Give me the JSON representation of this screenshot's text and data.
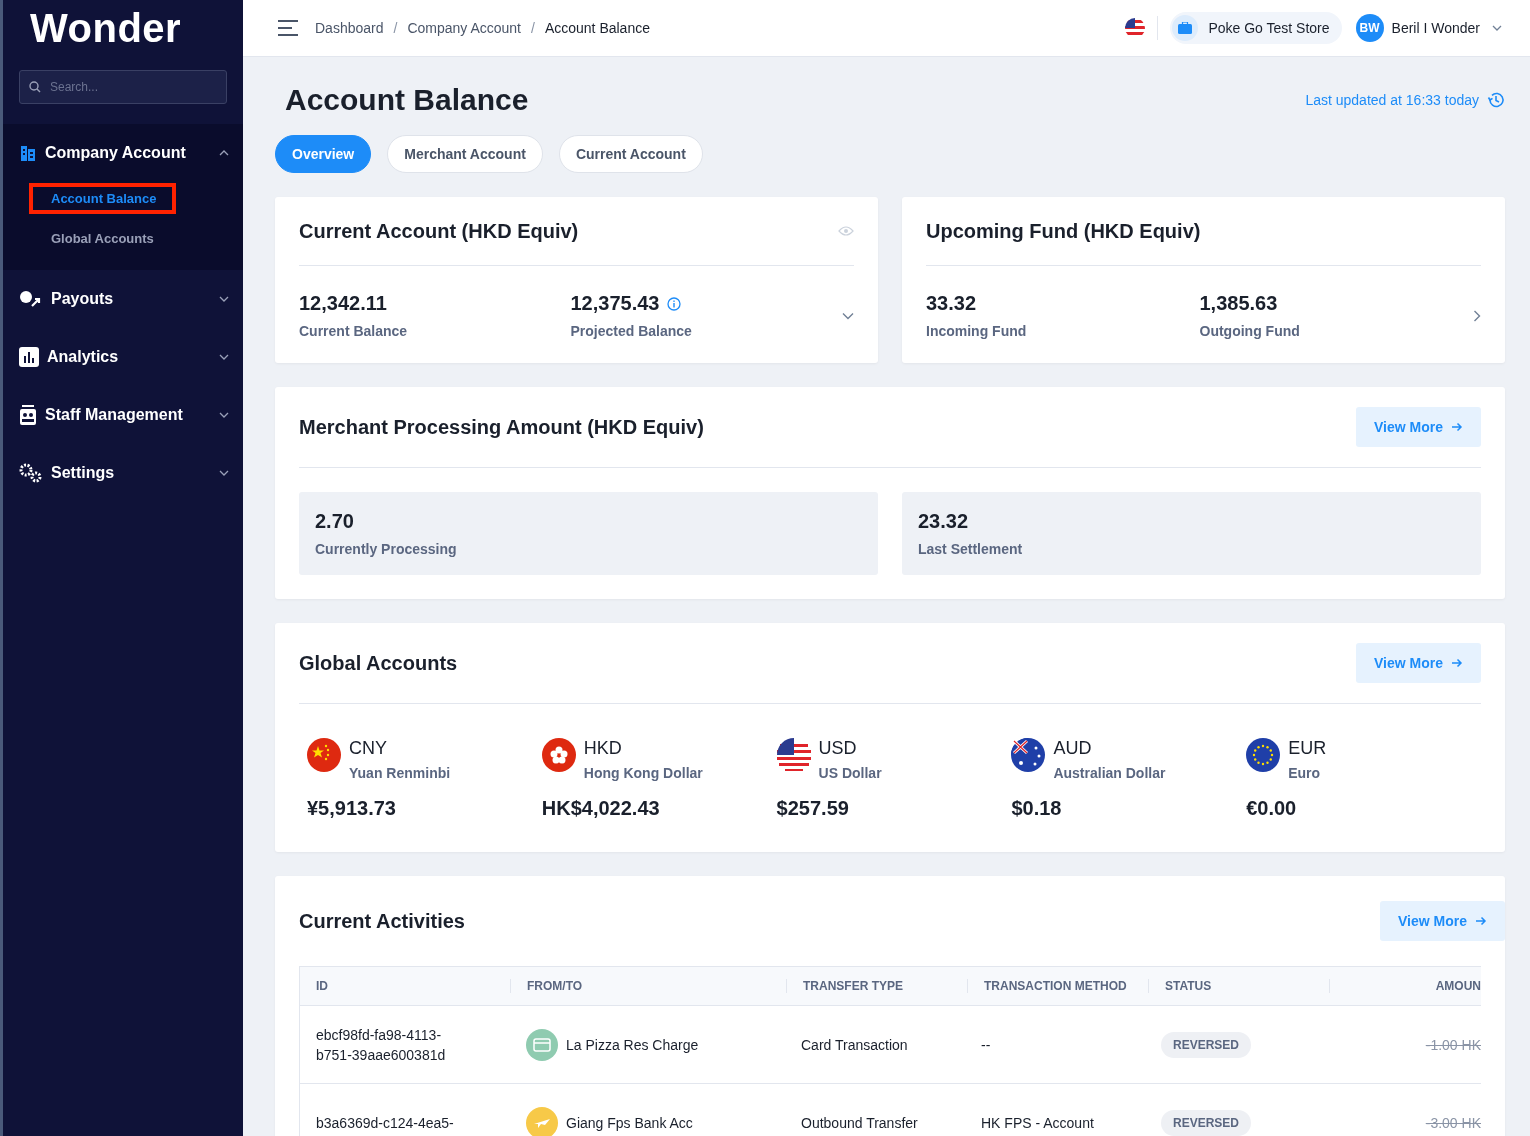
{
  "sidebar": {
    "logo": "Wonder",
    "search_placeholder": "Search...",
    "groups": [
      {
        "label": "Company Account",
        "expanded": true,
        "children": [
          {
            "label": "Account Balance",
            "selected": true,
            "highlighted": true
          },
          {
            "label": "Global Accounts",
            "selected": false,
            "highlighted": false
          }
        ]
      },
      {
        "label": "Payouts",
        "expanded": false
      },
      {
        "label": "Analytics",
        "expanded": false
      },
      {
        "label": "Staff Management",
        "expanded": false
      },
      {
        "label": "Settings",
        "expanded": false
      }
    ]
  },
  "header": {
    "breadcrumb_separator": "/",
    "breadcrumbs": [
      "Dashboard",
      "Company Account",
      "Account Balance"
    ],
    "store": "Poke Go Test Store",
    "user": {
      "initials": "BW",
      "name": "Beril I Wonder"
    }
  },
  "page": {
    "title": "Account Balance",
    "last_updated": "Last updated at 16:33 today",
    "tabs": [
      {
        "label": "Overview",
        "selected": true
      },
      {
        "label": "Merchant Account",
        "selected": false
      },
      {
        "label": "Current Account",
        "selected": false
      }
    ]
  },
  "current_account": {
    "title": "Current Account (HKD Equiv)",
    "items": [
      {
        "value": "12,342.11",
        "label": "Current Balance"
      },
      {
        "value": "12,375.43",
        "label": "Projected Balance"
      }
    ]
  },
  "upcoming_fund": {
    "title": "Upcoming Fund (HKD Equiv)",
    "items": [
      {
        "value": "33.32",
        "label": "Incoming Fund"
      },
      {
        "value": "1,385.63",
        "label": "Outgoing Fund"
      }
    ]
  },
  "merchant_processing": {
    "title": "Merchant Processing Amount (HKD Equiv)",
    "view_more": "View More",
    "items": [
      {
        "value": "2.70",
        "label": "Currently Processing"
      },
      {
        "value": "23.32",
        "label": "Last Settlement"
      }
    ]
  },
  "global_accounts": {
    "title": "Global Accounts",
    "view_more": "View More",
    "currencies": [
      {
        "code": "CNY",
        "name": "Yuan Renminbi",
        "amount": "¥5,913.73",
        "kind": "cn"
      },
      {
        "code": "HKD",
        "name": "Hong Kong Dollar",
        "amount": "HK$4,022.43",
        "kind": "hk"
      },
      {
        "code": "USD",
        "name": "US Dollar",
        "amount": "$257.59",
        "kind": "us"
      },
      {
        "code": "AUD",
        "name": "Australian Dollar",
        "amount": "$0.18",
        "kind": "au"
      },
      {
        "code": "EUR",
        "name": "Euro",
        "amount": "€0.00",
        "kind": "eu"
      }
    ]
  },
  "current_activities": {
    "title": "Current Activities",
    "view_more": "View More",
    "table": {
      "columns": [
        "ID",
        "FROM/TO",
        "TRANSFER TYPE",
        "TRANSACTION METHOD",
        "STATUS",
        "AMOUN"
      ],
      "rows": [
        {
          "id": [
            "ebcf98fd-fa98-4113-",
            "b751-39aae600381d"
          ],
          "from_to": "La Pizza Res Charge",
          "kind": "card",
          "color": "#8fcbb0",
          "transfer_type": "Card Transaction",
          "method": "--",
          "status": "REVERSED",
          "amount": "-1.00 HK"
        },
        {
          "id": [
            "b3a6369d-c124-4ea5-"
          ],
          "from_to": "Giang Fps Bank Acc",
          "kind": "plane",
          "color": "#f7c948",
          "transfer_type": "Outbound Transfer",
          "method": "HK FPS - Account",
          "status": "REVERSED",
          "amount": "-3.00 HK"
        }
      ]
    }
  }
}
